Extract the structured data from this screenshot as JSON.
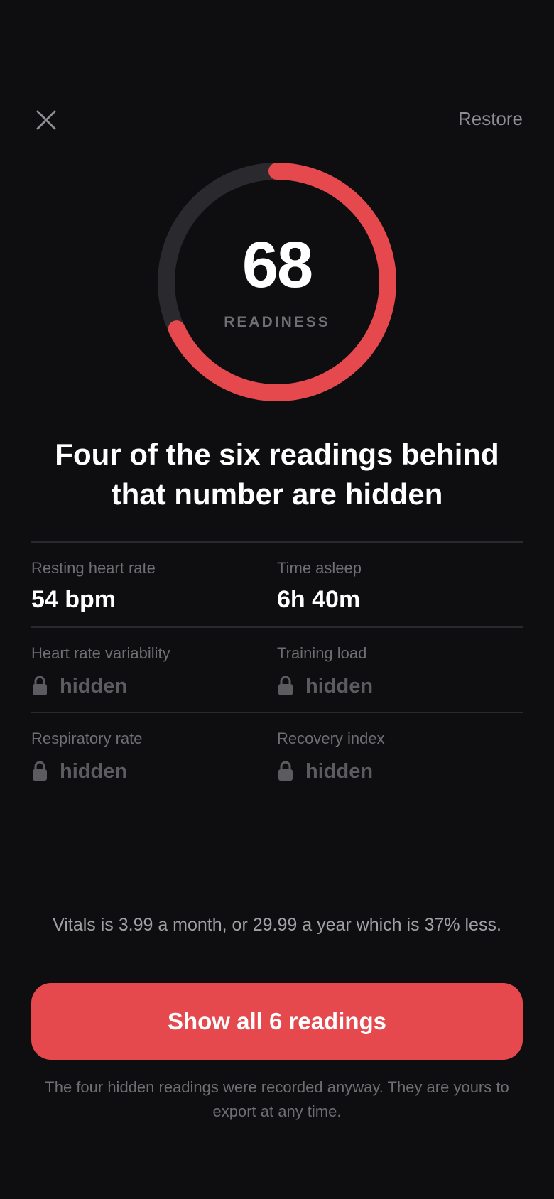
{
  "header": {
    "close_icon": "close-icon",
    "restore_label": "Restore"
  },
  "score": {
    "value": "68",
    "label": "READINESS",
    "percent": 68,
    "accent": "#e5484d",
    "track": "#2a2a2e"
  },
  "headline": "Four of the six readings behind that number are hidden",
  "readings": [
    {
      "label": "Resting heart rate",
      "value": "54 bpm",
      "hidden": false
    },
    {
      "label": "Time asleep",
      "value": "6h 40m",
      "hidden": false
    },
    {
      "label": "Heart rate variability",
      "value": "hidden",
      "hidden": true,
      "icon": "lock-icon"
    },
    {
      "label": "Training load",
      "value": "hidden",
      "hidden": true,
      "icon": "lock-icon"
    },
    {
      "label": "Respiratory rate",
      "value": "hidden",
      "hidden": true,
      "icon": "lock-icon"
    },
    {
      "label": "Recovery index",
      "value": "hidden",
      "hidden": true,
      "icon": "lock-icon"
    }
  ],
  "pricing_text": "Vitals is 3.99 a month, or 29.99 a year which is 37% less.",
  "cta_label": "Show all 6 readings",
  "footnote": "The four hidden readings were recorded anyway. They are yours to export at any time."
}
